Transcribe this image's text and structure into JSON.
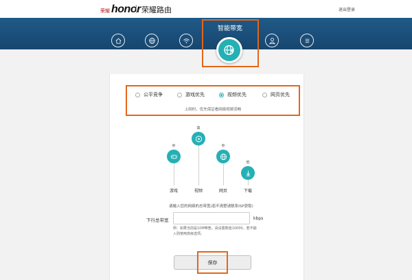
{
  "header": {
    "brand_small": "荣耀",
    "brand_name": "honor",
    "product": "荣耀路由",
    "logout_label": "退出登录"
  },
  "nav": {
    "items": [
      {
        "name": "home-icon"
      },
      {
        "name": "internet-globe-icon"
      },
      {
        "name": "wifi-icon"
      },
      {
        "name": "smart-bandwidth-icon",
        "label": "智能带宽",
        "active": true
      },
      {
        "name": "user-devices-icon"
      },
      {
        "name": "more-menu-icon"
      }
    ],
    "active_label": "智能带宽"
  },
  "modes": {
    "options": [
      {
        "label": "公平竞争",
        "selected": false
      },
      {
        "label": "游戏优先",
        "selected": false
      },
      {
        "label": "视频优先",
        "selected": true
      },
      {
        "label": "网页优先",
        "selected": false
      }
    ],
    "hint": "上网时，优先保证看网络视频流畅"
  },
  "priority": {
    "items": [
      {
        "name": "游戏",
        "level": "中",
        "icon": "gamepad-icon"
      },
      {
        "name": "视频",
        "level": "高",
        "icon": "play-icon"
      },
      {
        "name": "网页",
        "level": "中",
        "icon": "globe-icon"
      },
      {
        "name": "下载",
        "level": "低",
        "icon": "download-icon"
      }
    ]
  },
  "bandwidth": {
    "tip": "请输入您的网络的总带宽(若不清楚请联系ISP获取)",
    "label": "下行总带宽",
    "value": "",
    "unit": "kbps",
    "note": "例：如果当前是10M带宽，请设置数值10000，若不输入则使用高级选项。"
  },
  "actions": {
    "save_label": "保存"
  },
  "colors": {
    "nav_band": "#1f5a87",
    "accent_teal": "#25b0b4",
    "highlight_orange": "#e4651a"
  }
}
